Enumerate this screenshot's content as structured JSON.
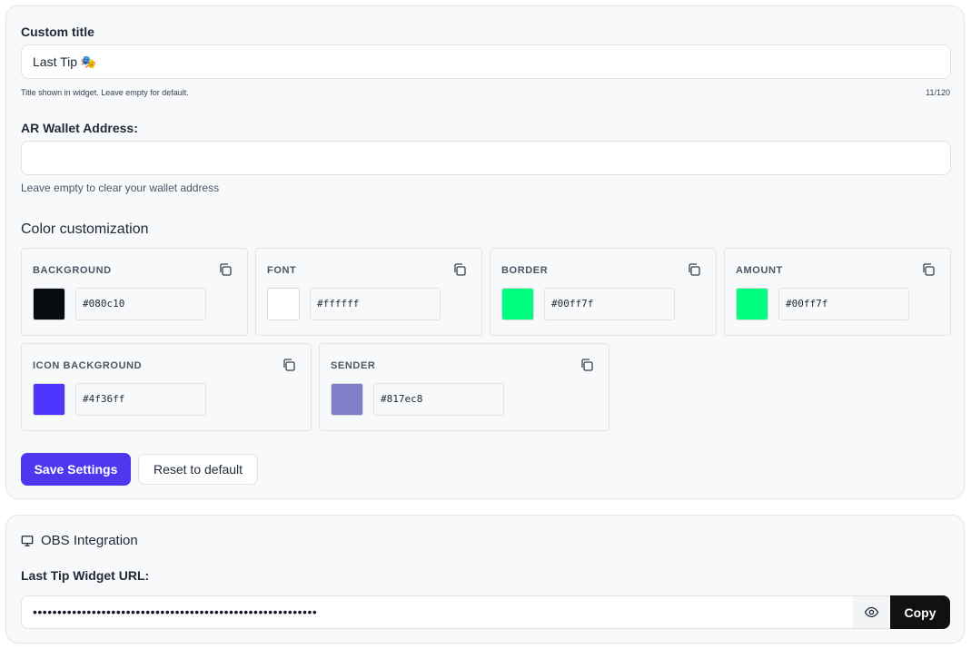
{
  "settings": {
    "custom_title": {
      "label": "Custom title",
      "value": "Last Tip 🎭",
      "hint": "Title shown in widget. Leave empty for default.",
      "counter": "11/120"
    },
    "wallet": {
      "label": "AR Wallet Address:",
      "value": "",
      "hint": "Leave empty to clear your wallet address"
    },
    "colors_title": "Color customization",
    "colors": [
      {
        "name": "BACKGROUND",
        "hex": "#080c10",
        "swatch": "#080c10"
      },
      {
        "name": "FONT",
        "hex": "#ffffff",
        "swatch": "#ffffff"
      },
      {
        "name": "BORDER",
        "hex": "#00ff7f",
        "swatch": "#00ff7f"
      },
      {
        "name": "AMOUNT",
        "hex": "#00ff7f",
        "swatch": "#00ff7f"
      },
      {
        "name": "ICON BACKGROUND",
        "hex": "#4f36ff",
        "swatch": "#4f36ff"
      },
      {
        "name": "SENDER",
        "hex": "#817ec8",
        "swatch": "#817ec8"
      }
    ],
    "save_label": "Save Settings",
    "reset_label": "Reset to default"
  },
  "obs": {
    "title": "OBS Integration",
    "url_label": "Last Tip Widget URL:",
    "url_value": "••••••••••••••••••••••••••••••••••••••••••••••••••••••••••",
    "copy_label": "Copy"
  },
  "icons": {
    "copy": "copy-icon",
    "monitor": "monitor-icon",
    "eye": "eye-icon"
  },
  "accent": "#4f36ef"
}
